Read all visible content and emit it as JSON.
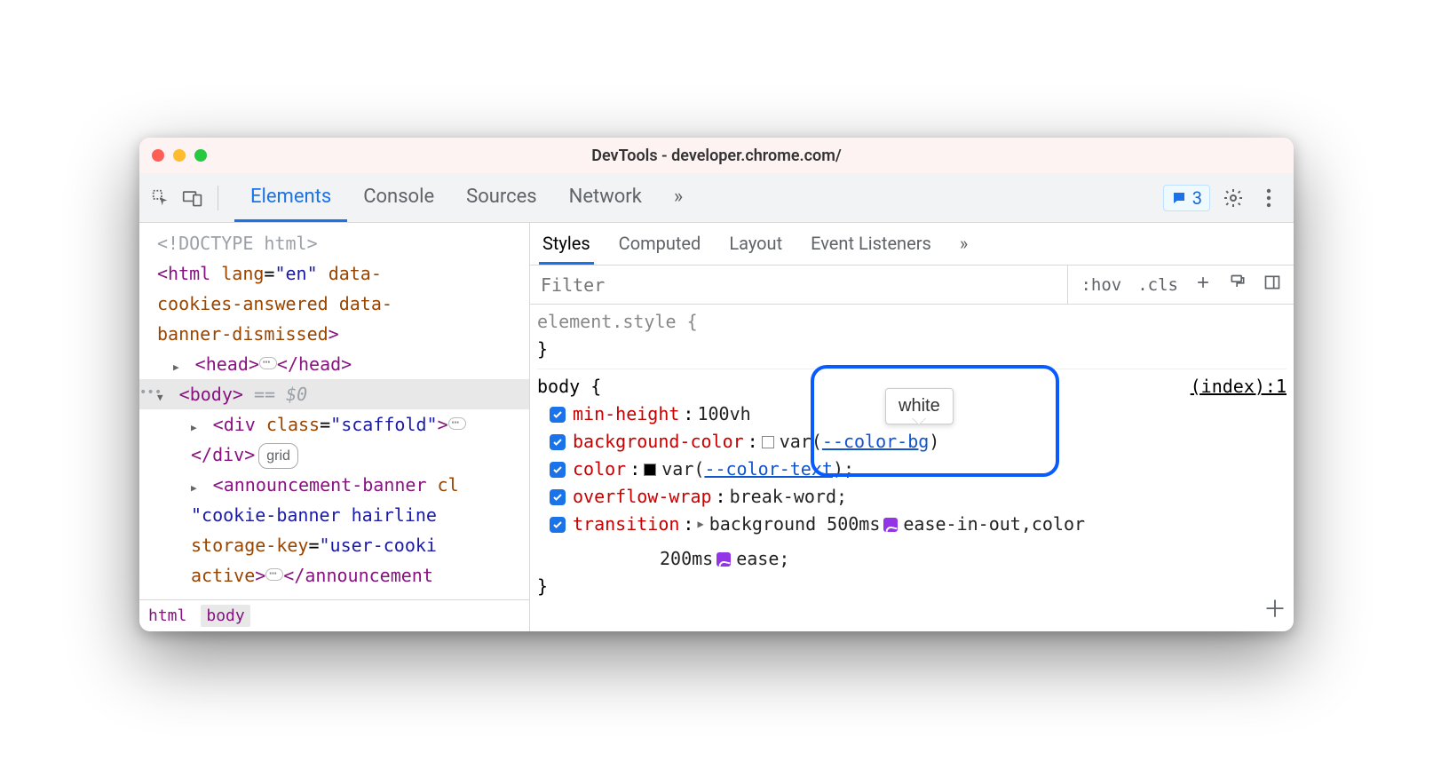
{
  "window": {
    "title": "DevTools - developer.chrome.com/"
  },
  "toolbar": {
    "tabs": [
      "Elements",
      "Console",
      "Sources",
      "Network"
    ],
    "issues_count": "3"
  },
  "dom": {
    "doctype": "<!DOCTYPE html>",
    "html_open": "<html lang=\"en\" data-cookies-answered data-banner-dismissed>",
    "head_open": "<head>",
    "head_close": "</head>",
    "body_open": "<body>",
    "body_suffix": "== $0",
    "div_open": "<div class=\"scaffold\">",
    "div_close": "</div>",
    "grid_badge": "grid",
    "announce_open": "<announcement-banner class=\"cookie-banner hairline storage-key=\"user-cookie active>",
    "announce_close": "</announcement"
  },
  "breadcrumb": {
    "html": "html",
    "body": "body"
  },
  "styles": {
    "tabs": [
      "Styles",
      "Computed",
      "Layout",
      "Event Listeners"
    ],
    "filter_placeholder": "Filter",
    "hov": ":hov",
    "cls": ".cls"
  },
  "css": {
    "elem_style": "element.style {",
    "close_brace": "}",
    "body_selector": "body {",
    "source": "(index):1",
    "decls": {
      "0": {
        "prop": "min-height",
        "val": "100vh"
      },
      "1": {
        "prop": "background-color",
        "var": "--color-bg",
        "resolved": "white"
      },
      "2": {
        "prop": "color",
        "var": "--color-text"
      },
      "3": {
        "prop": "overflow-wrap",
        "val": "break-word"
      },
      "4": {
        "prop": "transition",
        "val1": "background 500ms",
        "ease1": "ease-in-out",
        "val2": ",color",
        "val3": "200ms",
        "ease2": "ease"
      }
    }
  },
  "tooltip": {
    "text": "white"
  }
}
